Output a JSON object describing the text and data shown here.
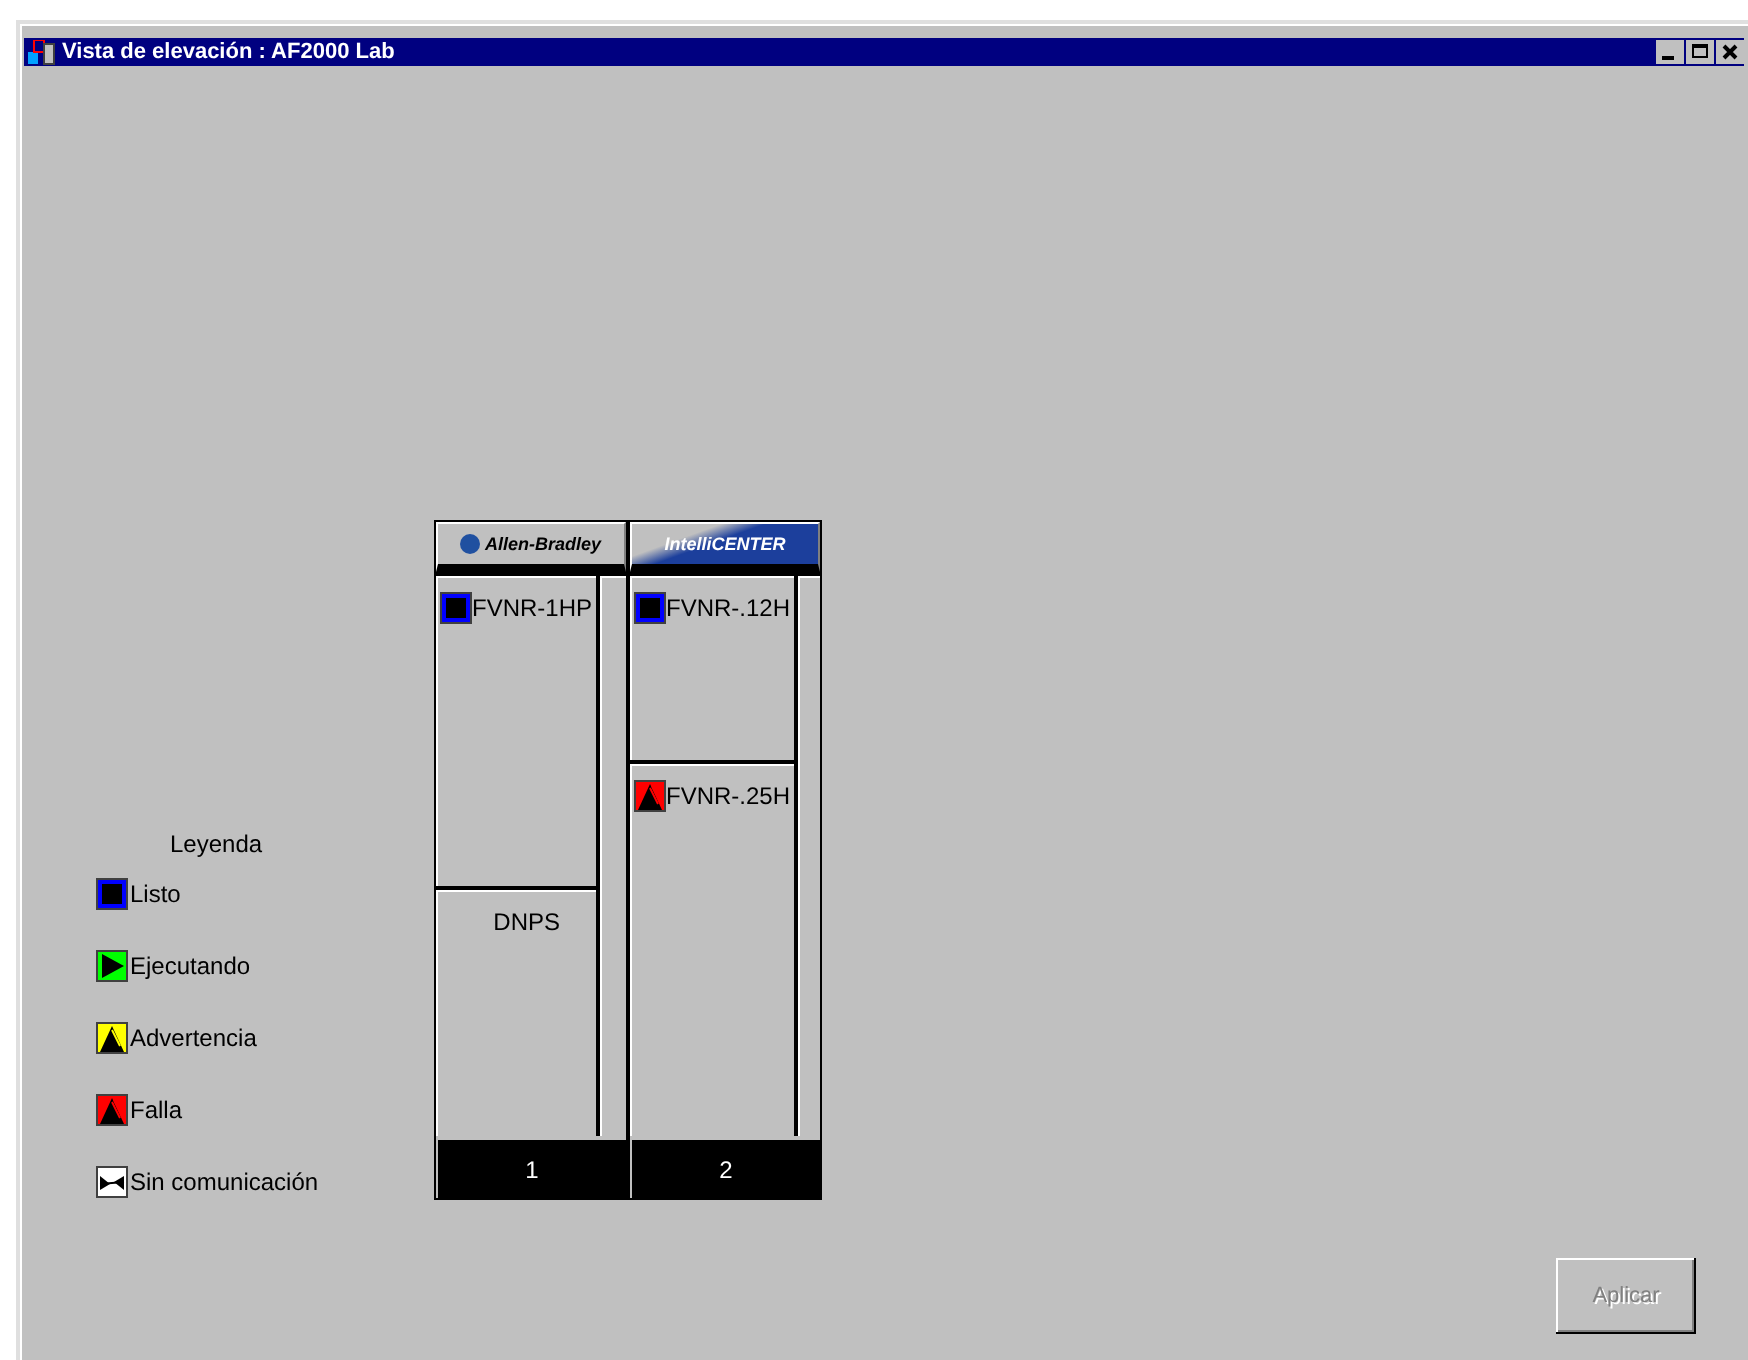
{
  "window": {
    "title": "Vista de elevación : AF2000 Lab"
  },
  "legend": {
    "title": "Leyenda",
    "items": [
      {
        "kind": "ready",
        "label": "Listo"
      },
      {
        "kind": "running",
        "label": "Ejecutando"
      },
      {
        "kind": "warning",
        "label": "Advertencia"
      },
      {
        "kind": "fault",
        "label": "Falla"
      },
      {
        "kind": "nocomm",
        "label": "Sin comunicación"
      }
    ]
  },
  "columns": [
    {
      "kind": "ab",
      "logo": "Allen-Bradley",
      "number": "1",
      "units": [
        {
          "kind": "ready",
          "name": "FVNR-1HP"
        },
        {
          "kind": "plain",
          "name": "DNPS"
        }
      ]
    },
    {
      "kind": "ic",
      "logo": "IntelliCENTER",
      "number": "2",
      "units": [
        {
          "kind": "ready",
          "name": "FVNR-.12H"
        },
        {
          "kind": "fault",
          "name": "FVNR-.25H"
        }
      ]
    }
  ],
  "apply_button": {
    "label": "Aplicar",
    "disabled": true
  }
}
